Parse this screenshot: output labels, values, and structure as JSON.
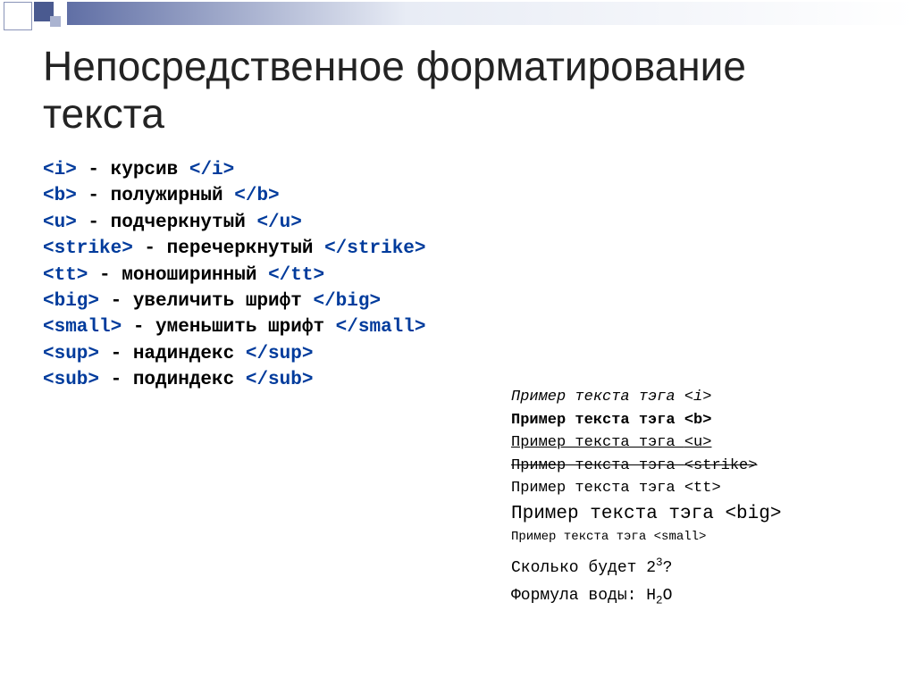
{
  "title": "Непосредственное форматирование текста",
  "tags": [
    {
      "open": "<i>",
      "desc": " - курсив ",
      "close": "</i>"
    },
    {
      "open": "<b>",
      "desc": " - полужирный ",
      "close": "</b>"
    },
    {
      "open": "<u>",
      "desc": " - подчеркнутый ",
      "close": "</u>"
    },
    {
      "open": "<strike>",
      "desc": " - перечеркнутый ",
      "close": "</strike>"
    },
    {
      "open": "<tt>",
      "desc": " - моноширинный ",
      "close": "</tt>"
    },
    {
      "open": "<big>",
      "desc": " - увеличить шрифт ",
      "close": "</big>"
    },
    {
      "open": "<small>",
      "desc": " - уменьшить шрифт ",
      "close": "</small>"
    },
    {
      "open": "<sup>",
      "desc": " - надиндекс ",
      "close": "</sup>"
    },
    {
      "open": "<sub>",
      "desc": " - подиндекс ",
      "close": "</sub>"
    }
  ],
  "example_prefix": "Пример текста тэга ",
  "examples": [
    {
      "style": "ex-i",
      "tag": "<i>"
    },
    {
      "style": "ex-b",
      "tag": "<b>"
    },
    {
      "style": "ex-u",
      "tag": "<u>"
    },
    {
      "style": "ex-strike",
      "tag": "<strike>"
    },
    {
      "style": "ex-tt",
      "tag": "<tt>"
    },
    {
      "style": "ex-big",
      "tag": "<big>"
    },
    {
      "style": "ex-small",
      "tag": "<small>"
    }
  ],
  "qa": {
    "q_prefix": "Сколько будет 2",
    "q_sup": "3",
    "q_suffix": "?",
    "f_prefix": "Формула воды: H",
    "f_sub": "2",
    "f_suffix": "O"
  }
}
